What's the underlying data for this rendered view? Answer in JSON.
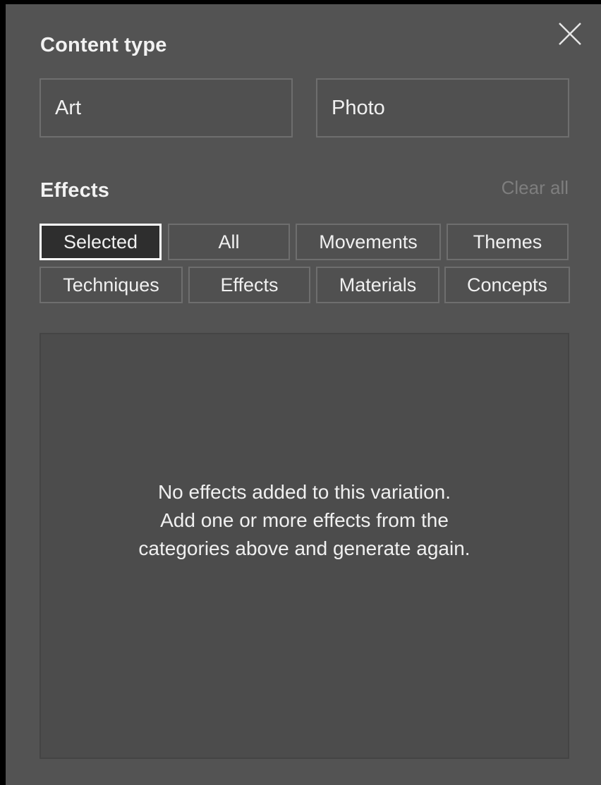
{
  "content_type": {
    "title": "Content type",
    "options": [
      "Art",
      "Photo"
    ]
  },
  "effects": {
    "title": "Effects",
    "clear_all_label": "Clear all",
    "tabs_row1": [
      "Selected",
      "All",
      "Movements",
      "Themes"
    ],
    "tabs_row2": [
      "Techniques",
      "Effects",
      "Materials",
      "Concepts"
    ],
    "selected_tab": "Selected",
    "empty_message": {
      "line1": "No effects added to this variation.",
      "line2": "Add one or more effects from the",
      "line3": "categories above and generate again."
    }
  },
  "colors": {
    "panel_background": "#535353",
    "selected_tab_border": "#ffffff",
    "muted_text": "#7e7e7e"
  },
  "icons": {
    "close": "close-icon"
  }
}
